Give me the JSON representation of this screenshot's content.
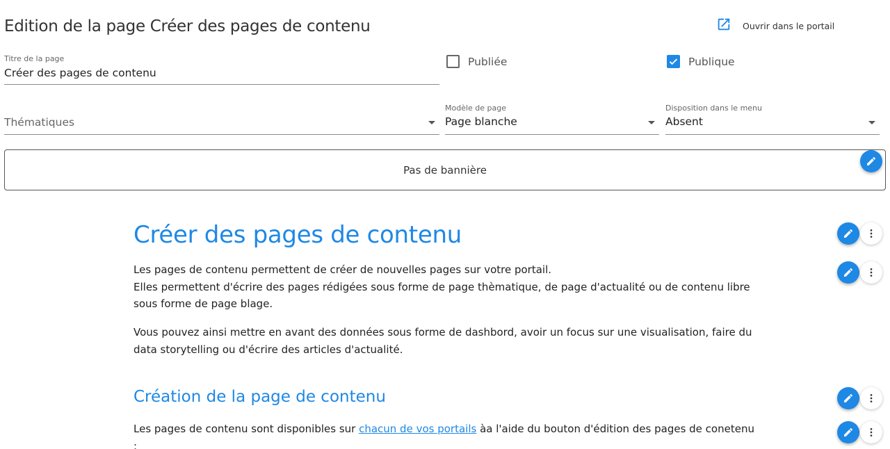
{
  "header": {
    "title": "Edition de la page Créer des pages de contenu",
    "open_portal_label": "Ouvrir dans le portail"
  },
  "form": {
    "page_title_label": "Titre de la page",
    "page_title_value": "Créer des pages de contenu",
    "published_label": "Publiée",
    "published_checked": false,
    "public_label": "Publique",
    "public_checked": true,
    "topics_placeholder": "Thématiques",
    "template_label": "Modèle de page",
    "template_value": "Page blanche",
    "menu_label": "Disposition dans le menu",
    "menu_value": "Absent"
  },
  "banner": {
    "text": "Pas de bannière"
  },
  "content": {
    "heading1": "Créer des pages de contenu",
    "para1_line1": "Les pages de contenu permettent de créer de nouvelles pages sur votre portail.",
    "para1_line2": "Elles permettent d'écrire des pages rédigées sous forme de page thèmatique, de page d'actualité ou de contenu libre sous forme de page blage.",
    "para2": "Vous pouvez ainsi mettre en avant des données sous forme de dashbord, avoir un focus sur une visualisation, faire du data storytelling ou d'écrire des articles d'actualité.",
    "heading2": "Création de la page de contenu",
    "para3_before": "Les pages de contenu sont disponibles sur ",
    "para3_link": "chacun de vos portails",
    "para3_after": " àa l'aide du bouton d'édition des pages de conetenu :"
  },
  "colors": {
    "accent": "#1e88e5",
    "text": "#222222"
  },
  "icons": {
    "open": "open-in-new-icon",
    "edit": "pencil-icon",
    "more": "more-vertical-icon",
    "check": "check-icon",
    "dropdown": "caret-down-icon"
  }
}
